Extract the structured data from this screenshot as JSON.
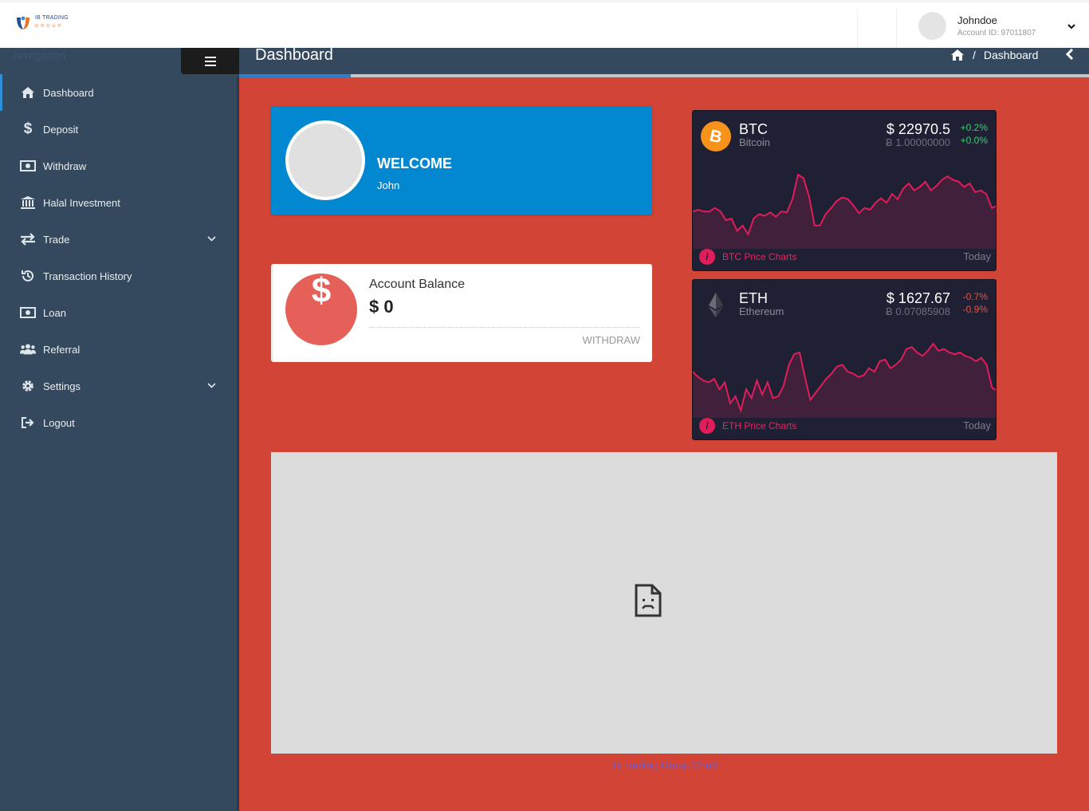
{
  "header": {
    "logo": {
      "line1": "IB TRADING",
      "line2": "GROUP"
    },
    "user": {
      "name": "Johndoe",
      "account_id": "Account ID: 97011807"
    }
  },
  "sidebar": {
    "caption": "Navigation",
    "items": [
      {
        "label": "Dashboard",
        "icon": "home-icon",
        "active": true
      },
      {
        "label": "Deposit",
        "icon": "dollar-icon"
      },
      {
        "label": "Withdraw",
        "icon": "money-icon"
      },
      {
        "label": "Halal Investment",
        "icon": "bank-icon"
      },
      {
        "label": "Trade",
        "icon": "exchange-icon",
        "has_submenu": true
      },
      {
        "label": "Transaction History",
        "icon": "history-icon"
      },
      {
        "label": "Loan",
        "icon": "money-icon"
      },
      {
        "label": "Referral",
        "icon": "users-icon"
      },
      {
        "label": "Settings",
        "icon": "gear-icon",
        "has_submenu": true
      },
      {
        "label": "Logout",
        "icon": "logout-icon"
      }
    ]
  },
  "page": {
    "title": "Dashboard",
    "breadcrumb": {
      "current": "Dashboard",
      "separator": "/"
    }
  },
  "welcome": {
    "title": "WELCOME",
    "name": "John"
  },
  "balance": {
    "symbol": "$",
    "label": "Account Balance",
    "value": "$ 0",
    "action": "WITHDRAW"
  },
  "crypto": [
    {
      "symbol": "BTC",
      "name": "Bitcoin",
      "price": "$ 22970.5",
      "btc_price": "Ƀ 1.00000000",
      "change_usd": "+0.2%",
      "change_btc": "+0.0%",
      "change_usd_color": "#35d46a",
      "change_btc_color": "#35d46a",
      "footer": "BTC Price Charts",
      "range": "Today",
      "icon_color": "#f7931a",
      "sparkline": [
        62,
        60,
        62,
        62,
        58,
        62,
        72,
        70,
        84,
        78,
        88,
        70,
        65,
        67,
        63,
        68,
        62,
        63,
        48,
        20,
        24,
        45,
        78,
        78,
        65,
        58,
        50,
        46,
        48,
        55,
        64,
        58,
        60,
        52,
        47,
        52,
        42,
        48,
        36,
        30,
        38,
        34,
        28,
        38,
        33,
        26,
        22,
        26,
        28,
        34,
        30,
        40,
        38,
        42,
        58,
        55
      ]
    },
    {
      "symbol": "ETH",
      "name": "Ethereum",
      "price": "$ 1627.67",
      "btc_price": "Ƀ 0.07085908",
      "change_usd": "-0.7%",
      "change_btc": "-0.9%",
      "change_usd_color": "#f0503c",
      "change_btc_color": "#f0503c",
      "footer": "ETH Price Charts",
      "range": "Today",
      "icon_color": "#2b2b3a",
      "sparkline": [
        52,
        58,
        62,
        64,
        60,
        72,
        64,
        88,
        80,
        96,
        72,
        82,
        62,
        78,
        64,
        82,
        80,
        68,
        44,
        32,
        30,
        58,
        84,
        76,
        68,
        60,
        54,
        46,
        44,
        52,
        54,
        58,
        56,
        48,
        52,
        40,
        38,
        48,
        44,
        38,
        26,
        24,
        30,
        34,
        28,
        20,
        28,
        26,
        30,
        32,
        30,
        34,
        36,
        40,
        36,
        44,
        70,
        74
      ]
    }
  ],
  "chart": {
    "link": "IB Trading Group Chart"
  }
}
